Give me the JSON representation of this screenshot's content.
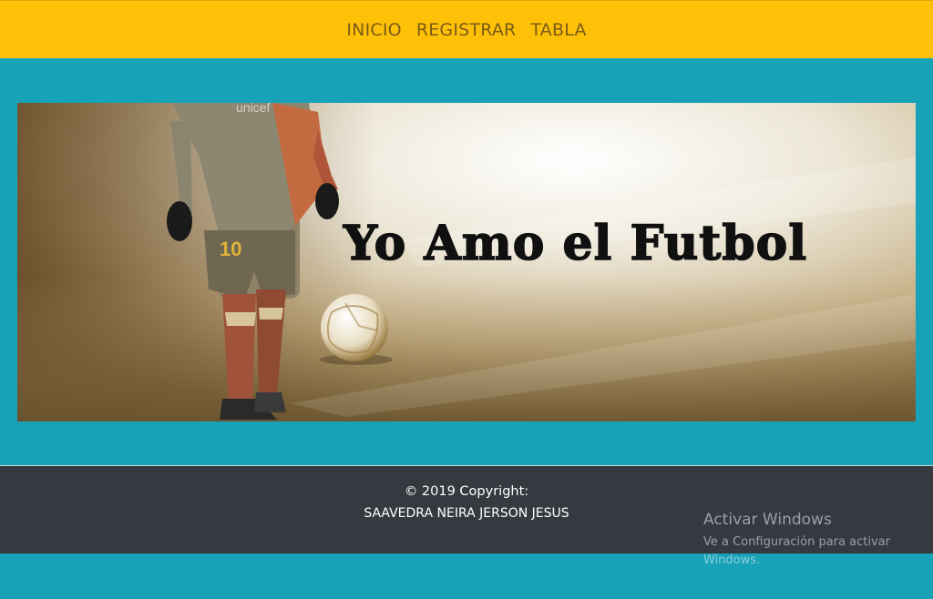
{
  "nav": {
    "items": [
      {
        "label": "INICIO"
      },
      {
        "label": "REGISTRAR"
      },
      {
        "label": "TABLA"
      }
    ]
  },
  "banner": {
    "headline": "Yo Amo el Futbol",
    "jersey_number": "10",
    "sponsor_text": "unicef"
  },
  "footer": {
    "copyright": "© 2019 Copyright:",
    "author": "SAAVEDRA NEIRA JERSON JESUS"
  },
  "watermark": {
    "title": "Activar Windows",
    "text": "Ve a Configuración para activar Windows."
  },
  "colors": {
    "navbar": "#ffc107",
    "page_background": "#17a2b8",
    "footer": "#343a40"
  }
}
